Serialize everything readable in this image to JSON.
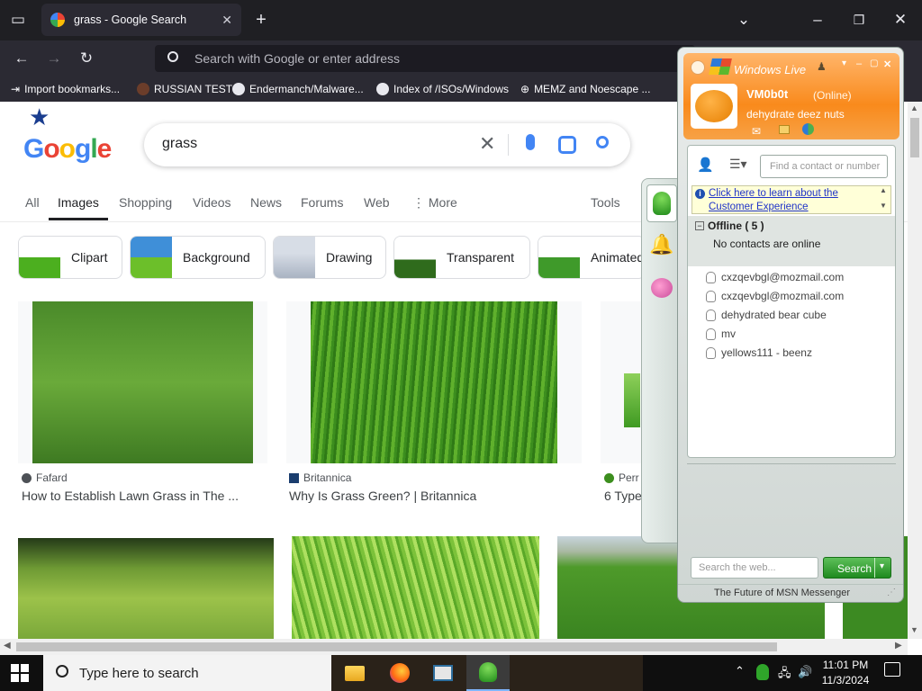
{
  "browser": {
    "tab_title": "grass - Google Search",
    "address_placeholder": "Search with Google or enter address",
    "bookmarks": [
      "Import bookmarks...",
      "RUSSIAN TEST",
      "Endermanch/Malware...",
      "Index of /ISOs/Windows",
      "MEMZ and Noescape ..."
    ]
  },
  "google": {
    "query": "grass",
    "tabs": [
      "All",
      "Images",
      "Shopping",
      "Videos",
      "News",
      "Forums",
      "Web",
      "More",
      "Tools"
    ],
    "active_tab": "Images",
    "chips": [
      "Clipart",
      "Background",
      "Drawing",
      "Transparent",
      "Animated"
    ],
    "results": [
      {
        "source": "Fafard",
        "title": "How to Establish Lawn Grass in The ..."
      },
      {
        "source": "Britannica",
        "title": "Why Is Grass Green? | Britannica"
      },
      {
        "source": "Perr",
        "title": "6 Type"
      }
    ]
  },
  "messenger": {
    "title": "Windows Live",
    "username": "VM0b0t",
    "status": "(Online)",
    "personal_message": "dehydrate deez nuts",
    "find_placeholder": "Find a contact or number",
    "banner_text": "Click here to learn about the Customer Experience",
    "group_label": "Offline ( 5 )",
    "no_contacts_msg": "No contacts are online",
    "contacts": [
      "cxzqevbgl@mozmail.com",
      "cxzqevbgl@mozmail.com",
      "dehydrated bear cube",
      "mv",
      "yellows111 - beenz"
    ],
    "web_search_placeholder": "Search the web...",
    "search_button": "Search",
    "footer": "The Future of MSN Messenger"
  },
  "taskbar": {
    "search_placeholder": "Type here to search",
    "time": "11:01 PM",
    "date": "11/3/2024"
  },
  "colors": {
    "msn_orange": "#f98a1c",
    "google_blue": "#4285f4",
    "chrome_dark": "#2b2a33"
  }
}
